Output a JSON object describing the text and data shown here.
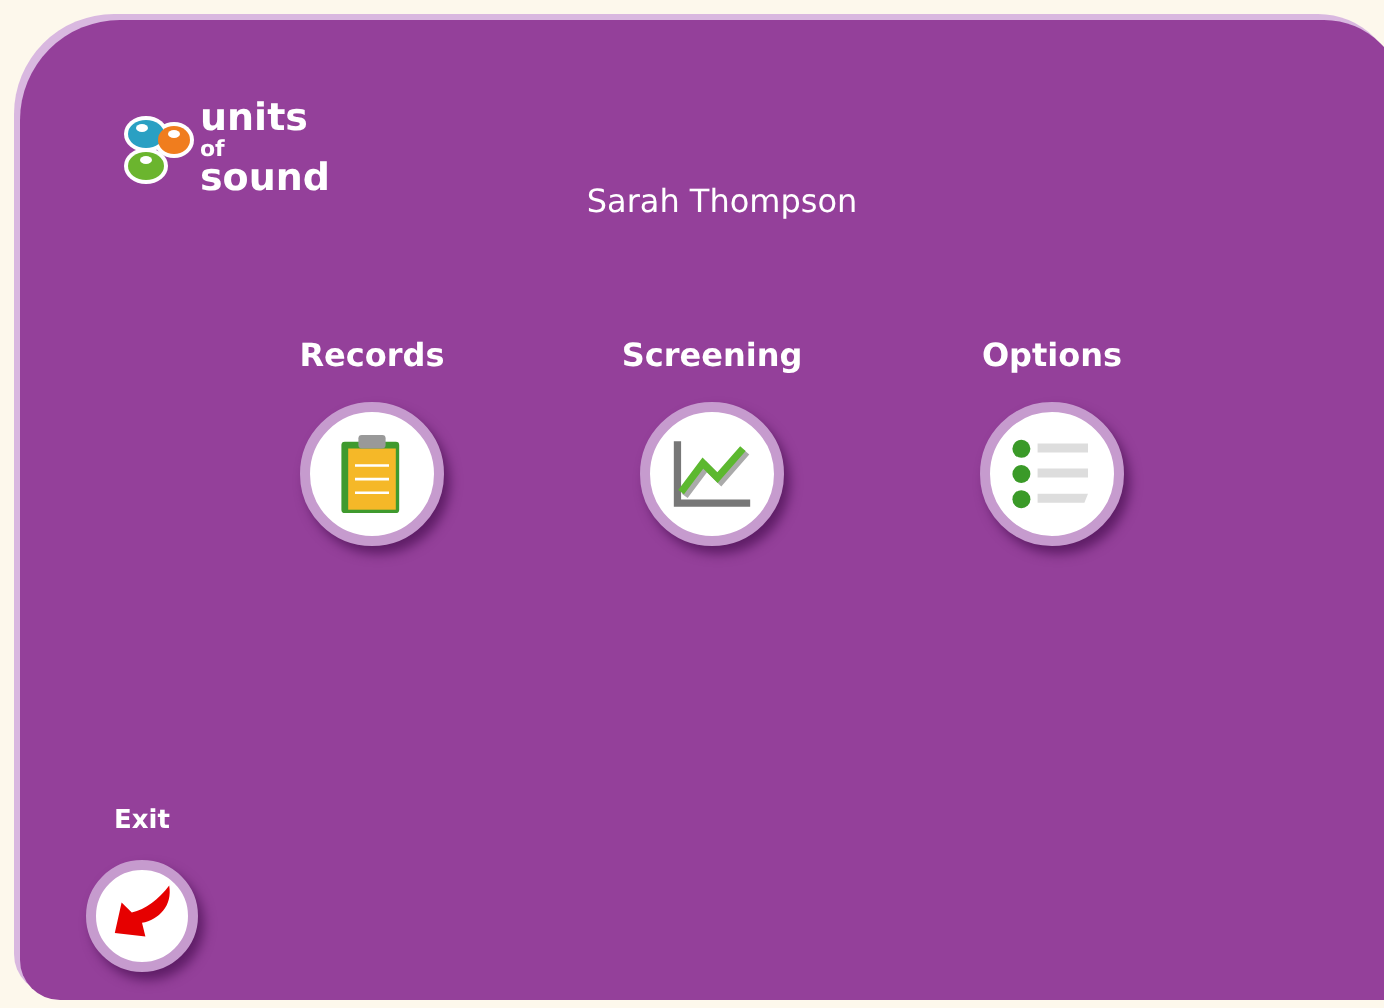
{
  "logo": {
    "words": [
      "units",
      "of",
      "sound"
    ]
  },
  "user_name": "Sarah Thompson",
  "menu": [
    {
      "label": "Records",
      "kind": "clipboard"
    },
    {
      "label": "Screening",
      "kind": "chart"
    },
    {
      "label": "Options",
      "kind": "list"
    }
  ],
  "exit": {
    "label": "Exit"
  }
}
